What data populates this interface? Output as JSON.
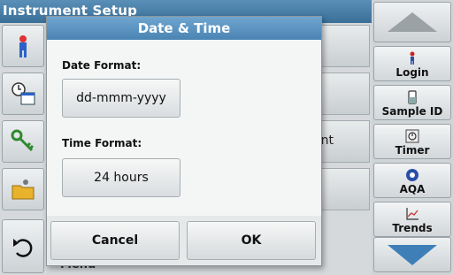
{
  "window": {
    "header_title": "Instrument Setup"
  },
  "background": {
    "row_fragment": "nt",
    "menu_fragment": "Menu"
  },
  "dialog": {
    "title": "Date & Time",
    "date_format_label": "Date Format:",
    "date_format_value": "dd-mmm-yyyy",
    "time_format_label": "Time Format:",
    "time_format_value": "24 hours",
    "cancel_label": "Cancel",
    "ok_label": "OK"
  },
  "sidebar": {
    "items": [
      {
        "label": "Login",
        "icon": "person-icon"
      },
      {
        "label": "Sample ID",
        "icon": "vial-icon"
      },
      {
        "label": "Timer",
        "icon": "timer-icon"
      },
      {
        "label": "AQA",
        "icon": "aqa-icon"
      },
      {
        "label": "Trends",
        "icon": "trend-chart-icon"
      }
    ]
  },
  "colors": {
    "title_bar": "#4a84b3",
    "accent_arrow": "#3f7fb8"
  }
}
